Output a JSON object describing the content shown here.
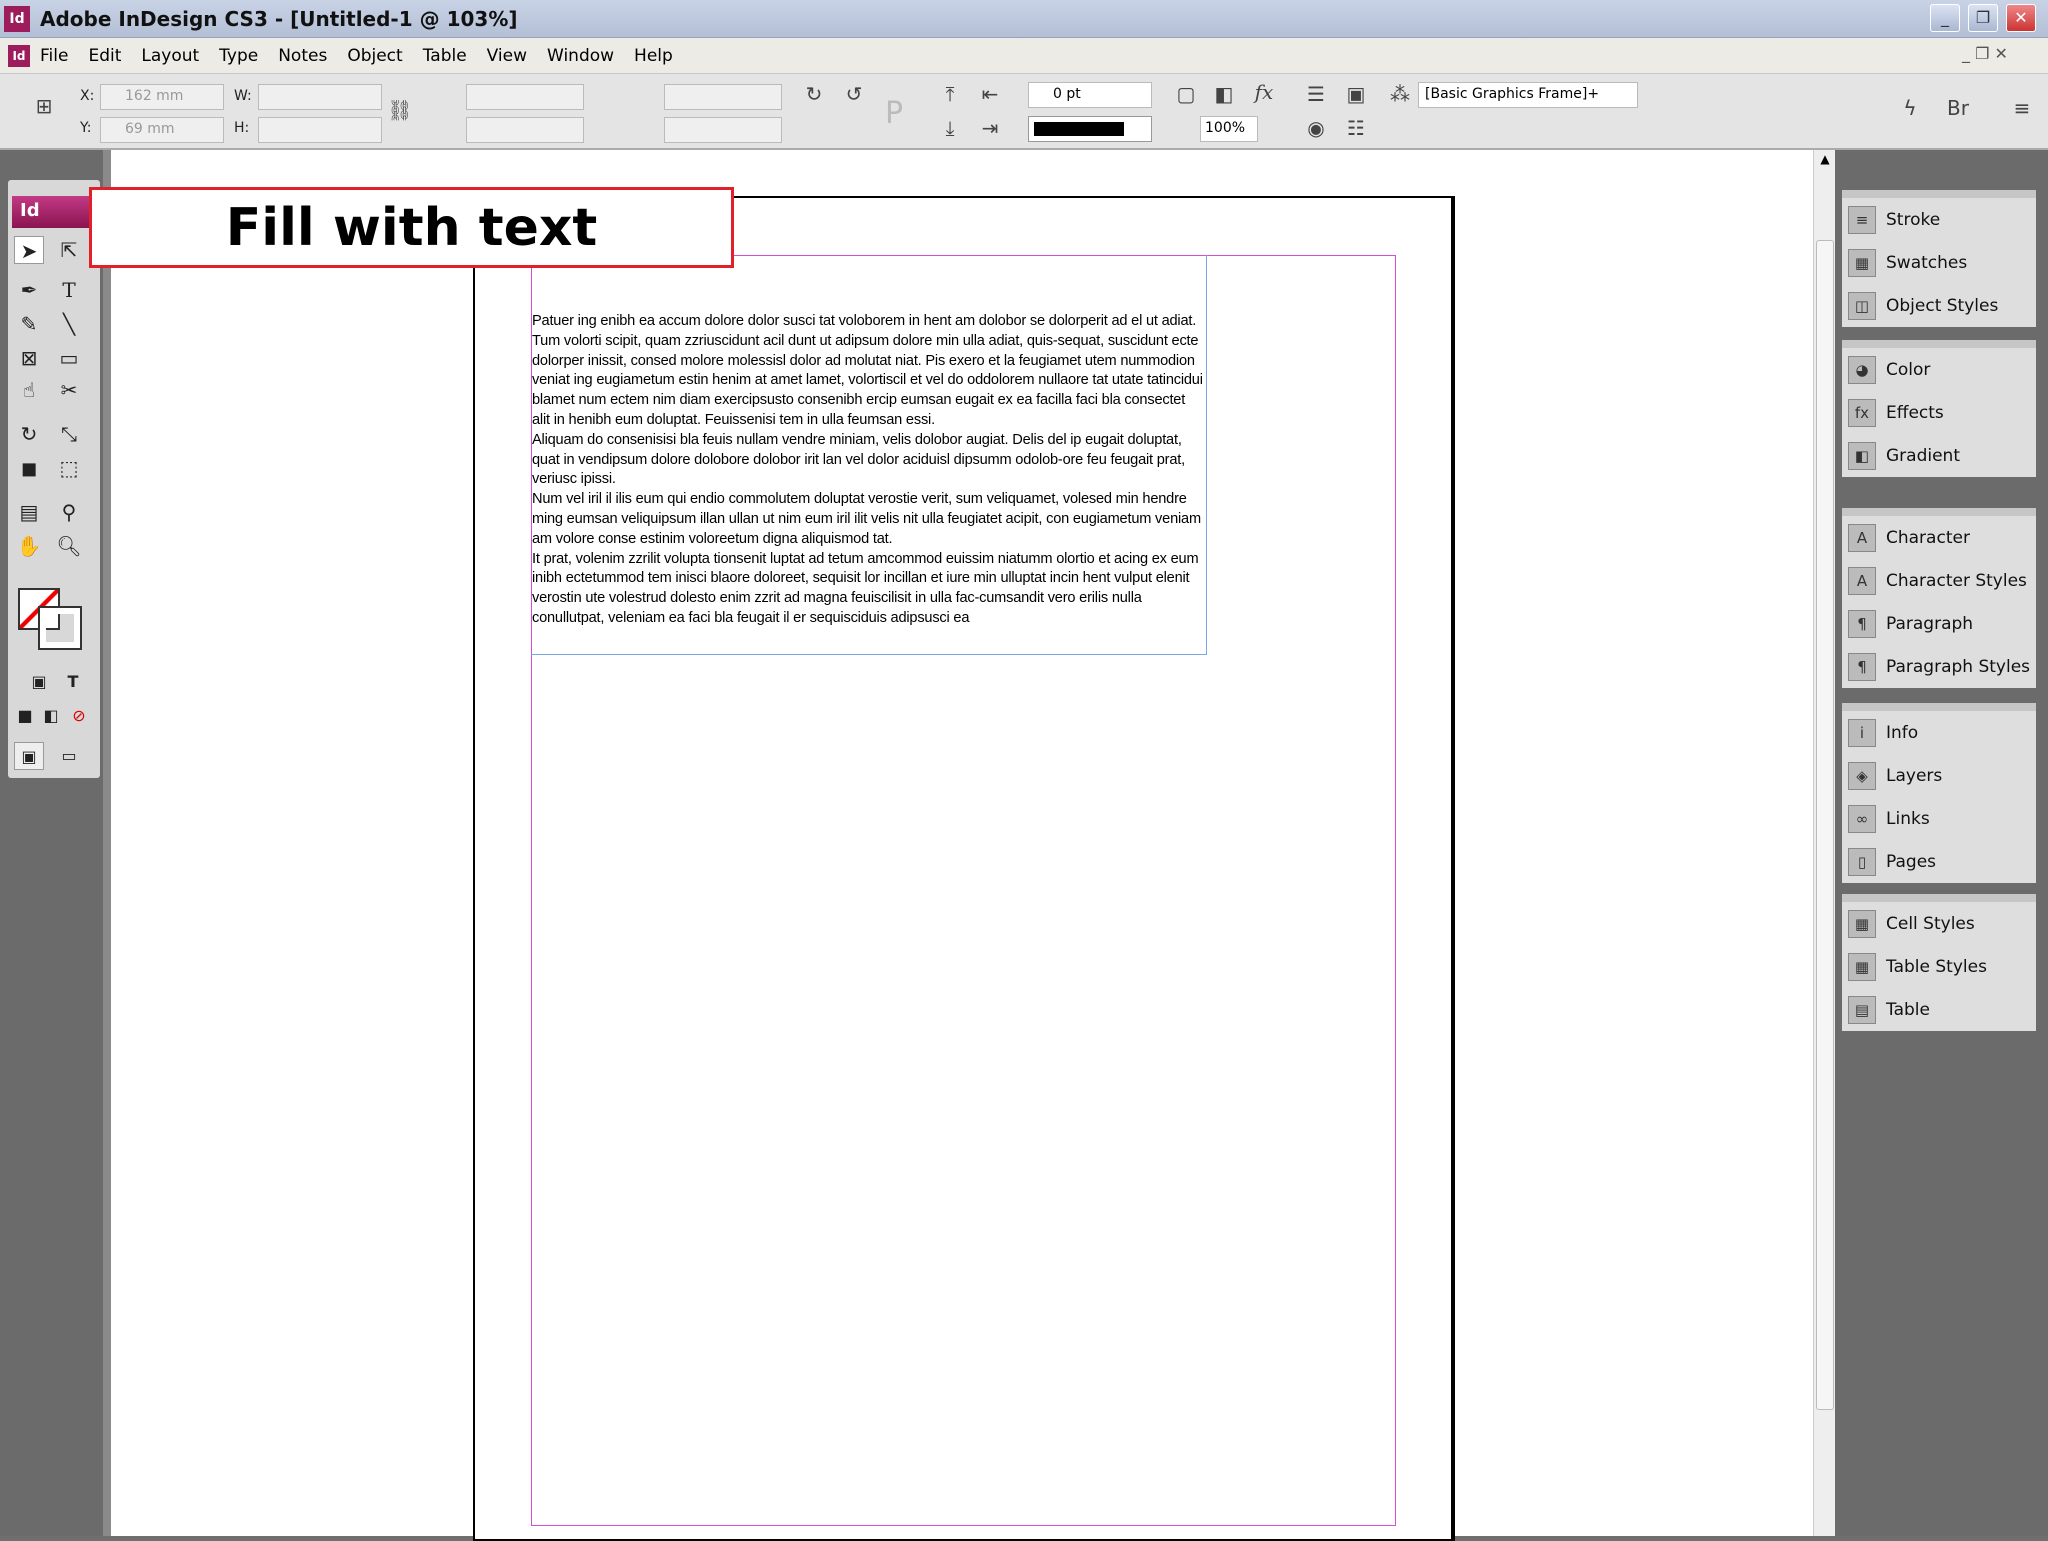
{
  "window": {
    "title": "Adobe InDesign CS3 - [Untitled-1 @ 103%]",
    "app_icon": "Id"
  },
  "menu": [
    "File",
    "Edit",
    "Layout",
    "Type",
    "Notes",
    "Object",
    "Table",
    "View",
    "Window",
    "Help"
  ],
  "control": {
    "x_label": "X:",
    "x_value": "162 mm",
    "y_label": "Y:",
    "y_value": "69 mm",
    "w_label": "W:",
    "h_label": "H:",
    "stroke_weight": "0 pt",
    "opacity": "100%",
    "object_style": "[Basic Graphics Frame]+"
  },
  "tools_header": "Id",
  "overlay_label": "Fill with text",
  "story": [
    "Patuer ing enibh ea accum dolore dolor susci tat voloborem in hent am dolobor se dolorperit ad el ut adiat. Tum volorti scipit, quam zzriuscidunt acil dunt ut adipsum dolore min ulla adiat, quis-sequat, suscidunt ecte dolorper inissit, consed molore molessisl dolor ad molutat niat. Pis exero et la feugiamet utem nummodion veniat ing eugiametum estin henim at amet lamet, volortiscil et vel do oddolorem nullaore tat utate tatincidui blamet num ectem nim diam exercipsusto consenibh ercip eumsan eugait ex ea facilla faci bla consectet alit in henibh eum doluptat. Feuissenisi tem in ulla feumsan essi.",
    "Aliquam do consenisisi bla feuis nullam vendre miniam, velis dolobor augiat. Delis del ip eugait doluptat, quat in vendipsum dolore dolobore dolobor irit lan vel dolor aciduisl dipsumm odolob-ore feu feugait prat, veriusc ipissi.",
    "Num vel iril il ilis eum qui endio commolutem doluptat verostie verit, sum veliquamet, volesed min hendre ming eumsan veliquipsum illan ullan ut nim eum iril ilit velis nit ulla feugiatet acipit, con eugiametum veniam am volore conse estinim voloreetum digna aliquismod tat.",
    "It prat, volenim zzrilit volupta tionsenit luptat ad tetum amcommod euissim niatumm olortio et acing ex eum inibh ectetummod tem inisci blaore doloreet, sequisit lor incillan et iure min ulluptat incin hent vulput elenit verostin ute volestrud dolesto enim zzrit ad magna feuiscilisit in ulla fac-cumsandit vero erilis nulla conullutpat, veleniam ea faci bla feugait il er sequisciduis adipsusci ea"
  ],
  "panels": [
    [
      "Stroke",
      "Swatches",
      "Object Styles"
    ],
    [
      "Color",
      "Effects",
      "Gradient"
    ],
    [
      "Character",
      "Character Styles",
      "Paragraph",
      "Paragraph Styles"
    ],
    [
      "Info",
      "Layers",
      "Links",
      "Pages"
    ],
    [
      "Cell Styles",
      "Table Styles",
      "Table"
    ]
  ]
}
